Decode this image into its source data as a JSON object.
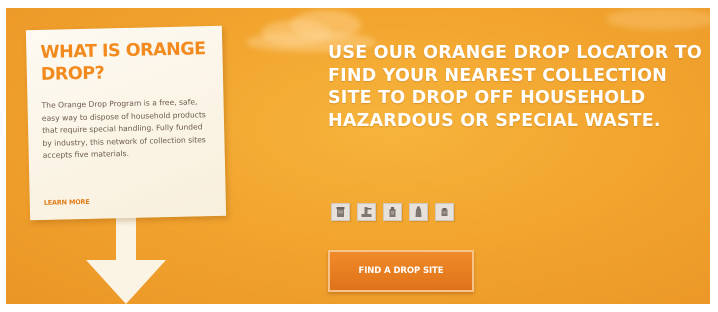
{
  "info_card": {
    "title": "WHAT IS ORANGE DROP?",
    "body": "The Orange Drop Program is a free, safe, easy way to dispose of household products that require special handling. Fully funded by industry, this network of collection sites accepts five materials.",
    "learn_more_label": "LEARN MORE"
  },
  "hero": {
    "headline": "USE OUR ORANGE DROP LOCATOR TO FIND YOUR NEAREST COLLECTION SITE TO DROP OFF HOUSEHOLD HAZARDOUS OR SPECIAL WASTE."
  },
  "material_icons": [
    {
      "icon": "paint-can-icon"
    },
    {
      "icon": "pesticide-sprayer-icon"
    },
    {
      "icon": "solvent-container-icon"
    },
    {
      "icon": "lubricating-oil-icon"
    },
    {
      "icon": "fertilizer-bag-icon"
    }
  ],
  "cta": {
    "label": "FIND A DROP SITE"
  },
  "colors": {
    "banner_orange": "#f2a52f",
    "title_orange": "#f28a1e",
    "button_orange": "#e0721a",
    "card_cream": "#fefaf2",
    "icon_gray": "#807870"
  }
}
